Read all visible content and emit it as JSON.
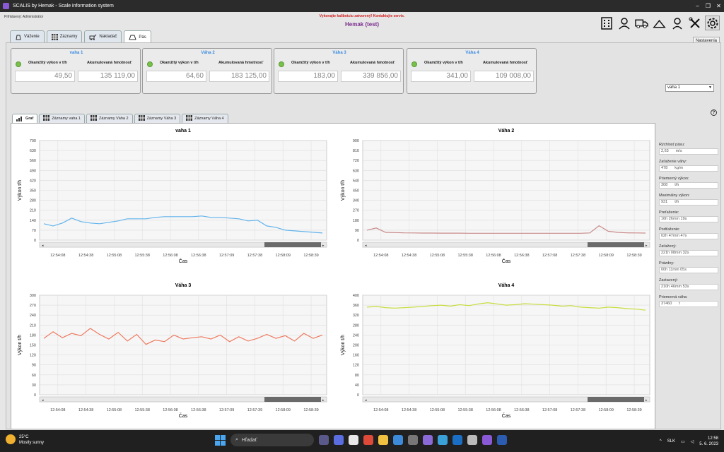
{
  "window": {
    "title": "SCALIS by Hemak - Scale information system",
    "min": "–",
    "max": "❐",
    "close": "✕"
  },
  "header": {
    "user": "Prihlásený: Administrátor",
    "warning": "Vykonajte kalibráciu zatvorený! Kontaktujte servis.",
    "company": "Hemak (test)",
    "tooltip": "Nastavenia",
    "icons": [
      "building-icon",
      "person-icon",
      "truck-icon",
      "scale-icon",
      "user-icon",
      "tools-icon",
      "gear-icon"
    ]
  },
  "main_tabs": [
    {
      "label": "Váženie"
    },
    {
      "label": "Záznamy"
    },
    {
      "label": "Nakladač"
    },
    {
      "label": "Pás"
    }
  ],
  "labels": {
    "instant": "Okamžitý výkon v t/h",
    "accum": "Akumulovaná hmotnosť"
  },
  "scales": [
    {
      "name": "vaha 1",
      "instant": "49,50",
      "accum": "135 119,00"
    },
    {
      "name": "Váha 2",
      "instant": "64,60",
      "accum": "183 125,00"
    },
    {
      "name": "Váha 3",
      "instant": "183,00",
      "accum": "339 856,00"
    },
    {
      "name": "Váha 4",
      "instant": "341,00",
      "accum": "109 008,00"
    }
  ],
  "scale_select": "vaha 1",
  "help": "?",
  "sub_tabs": [
    {
      "label": "Graf"
    },
    {
      "label": "Záznamy vaha 1"
    },
    {
      "label": "Záznamy Váha 2"
    },
    {
      "label": "Záznamy Váha 3"
    },
    {
      "label": "Záznamy Váha 4"
    }
  ],
  "chart_data": [
    {
      "type": "line",
      "title": "vaha 1",
      "xlabel": "Čas",
      "ylabel": "Výkon t/h",
      "ylim": [
        0,
        700
      ],
      "yticks": [
        "0",
        "70",
        "140",
        "210",
        "280",
        "350",
        "420",
        "490",
        "560",
        "630",
        "700"
      ],
      "x": [
        "12:54:08",
        "12:54:38",
        "12:55:08",
        "12:55:38",
        "12:56:08",
        "12:56:38",
        "12:57:09",
        "12:57:38",
        "12:58:09",
        "12:58:39"
      ],
      "color": "#62b4ec",
      "values": [
        115,
        100,
        120,
        155,
        130,
        120,
        115,
        125,
        135,
        150,
        150,
        150,
        160,
        165,
        165,
        165,
        165,
        170,
        160,
        160,
        155,
        150,
        135,
        140,
        100,
        90,
        70,
        65,
        60,
        55,
        50
      ]
    },
    {
      "type": "line",
      "title": "Váha 2",
      "xlabel": "Čas",
      "ylabel": "Výkon t/h",
      "ylim": [
        0,
        900
      ],
      "yticks": [
        "0",
        "90",
        "180",
        "270",
        "340",
        "450",
        "540",
        "630",
        "720",
        "810",
        "900"
      ],
      "x": [
        "12:54:08",
        "12:54:38",
        "12:55:08",
        "12:55:38",
        "12:56:08",
        "12:56:38",
        "12:57:08",
        "12:57:38",
        "12:58:09",
        "12:58:39"
      ],
      "color": "#c98a8a",
      "values": [
        90,
        110,
        70,
        68,
        66,
        65,
        64,
        64,
        63,
        63,
        63,
        62,
        62,
        62,
        62,
        62,
        62,
        62,
        62,
        62,
        62,
        62,
        62,
        62,
        65,
        130,
        80,
        70,
        66,
        65,
        64
      ]
    },
    {
      "type": "line",
      "title": "Váha 3",
      "xlabel": "Čas",
      "ylabel": "Výkon t/h",
      "ylim": [
        0,
        300
      ],
      "yticks": [
        "0",
        "30",
        "60",
        "90",
        "120",
        "150",
        "180",
        "210",
        "240",
        "270",
        "300"
      ],
      "x": [
        "12:54:08",
        "12:54:38",
        "12:55:08",
        "12:55:38",
        "12:56:08",
        "12:56:38",
        "12:57:09",
        "12:57:39",
        "12:58:09",
        "12:58:39"
      ],
      "color": "#ee7a60",
      "values": [
        170,
        190,
        172,
        185,
        178,
        200,
        182,
        168,
        188,
        162,
        182,
        152,
        165,
        160,
        180,
        168,
        172,
        175,
        168,
        180,
        160,
        175,
        162,
        170,
        182,
        170,
        178,
        162,
        185,
        170,
        180
      ]
    },
    {
      "type": "line",
      "title": "Váha 4",
      "xlabel": "Čas",
      "ylabel": "Výkon t/h",
      "ylim": [
        0,
        400
      ],
      "yticks": [
        "0",
        "40",
        "80",
        "120",
        "160",
        "200",
        "240",
        "280",
        "320",
        "360",
        "400"
      ],
      "x": [
        "12:54:08",
        "12:54:38",
        "12:55:08",
        "12:55:38",
        "12:56:08",
        "12:56:38",
        "12:57:08",
        "12:57:38",
        "12:58:09",
        "12:58:39"
      ],
      "color": "#c8dc3c",
      "values": [
        352,
        355,
        350,
        348,
        350,
        352,
        355,
        358,
        360,
        356,
        362,
        358,
        365,
        370,
        365,
        360,
        362,
        366,
        364,
        362,
        360,
        356,
        358,
        352,
        350,
        348,
        352,
        350,
        346,
        344,
        340
      ]
    }
  ],
  "stats": [
    {
      "label": "Rýchlosť pásu:",
      "value": "2,63",
      "unit": "m/s"
    },
    {
      "label": "Zaťaženie váhy:",
      "value": "478",
      "unit": "kg/m"
    },
    {
      "label": "Priemerný výkon:",
      "value": "308",
      "unit": "t/h"
    },
    {
      "label": "Maximálny výkon:",
      "value": "931",
      "unit": "t/h"
    },
    {
      "label": "Preťaženie:",
      "value": "16h 26mm 19s"
    },
    {
      "label": "Podťaženie:",
      "value": "02h 47mm 47s"
    },
    {
      "label": "Zaťažený:",
      "value": "221h 08mm 32s"
    },
    {
      "label": "Prázdny:",
      "value": "00h 11mm 05s"
    },
    {
      "label": "Zastavený:",
      "value": "210h 46mm 53s"
    },
    {
      "label": "Priemerná váha:",
      "value": "37460",
      "unit": "t"
    }
  ],
  "taskbar": {
    "temp": "25°C",
    "weather": "Mostly sunny",
    "search": "Hľadať",
    "lang": "SLK",
    "time": "12:58",
    "date": "5. 6. 2023",
    "up": "^"
  }
}
